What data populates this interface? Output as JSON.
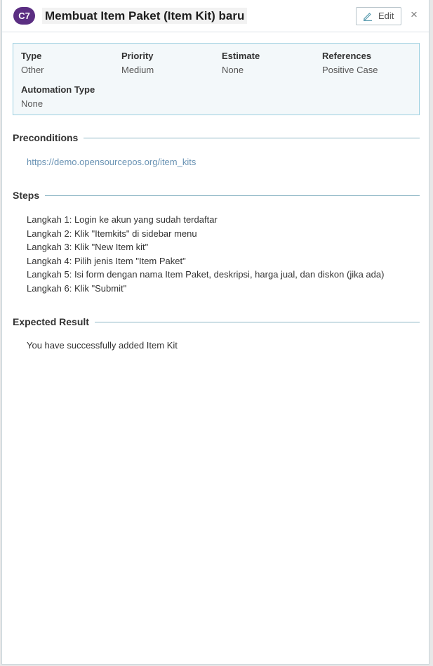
{
  "header": {
    "badge": "C7",
    "title": "Membuat Item Paket (Item Kit) baru",
    "edit_label": "Edit",
    "close_label": "×"
  },
  "props": [
    {
      "key": "Type",
      "value": "Other"
    },
    {
      "key": "Priority",
      "value": "Medium"
    },
    {
      "key": "Estimate",
      "value": "None"
    },
    {
      "key": "References",
      "value": "Positive Case"
    },
    {
      "key": "Automation Type",
      "value": "None"
    }
  ],
  "preconditions": {
    "heading": "Preconditions",
    "link": "https://demo.opensourcepos.org/item_kits"
  },
  "steps": {
    "heading": "Steps",
    "items": [
      "Langkah 1: Login ke akun yang sudah terdaftar",
      "Langkah 2: Klik \"Itemkits\" di sidebar menu",
      "Langkah 3: Klik \"New Item kit\"",
      "Langkah 4: Pilih jenis Item \"Item Paket\"",
      "Langkah 5: Isi form dengan nama Item Paket, deskripsi, harga jual, dan diskon (jika ada)",
      "Langkah 6: Klik \"Submit\""
    ]
  },
  "expected": {
    "heading": "Expected Result",
    "text": "You have successfully added Item Kit"
  },
  "colors": {
    "badge": "#5b2e82",
    "props_border": "#9ccfe0",
    "props_bg": "#f3f8fa",
    "link": "#6a93b4",
    "divider": "#8fb7c6"
  }
}
